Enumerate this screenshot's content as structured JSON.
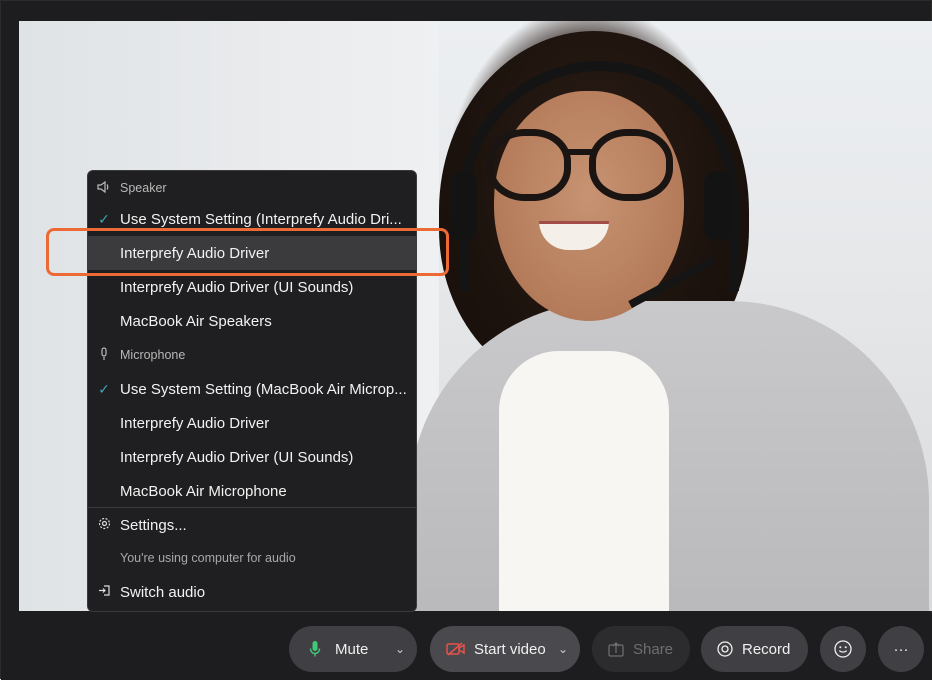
{
  "colors": {
    "accent_check": "#3aa6b9",
    "annotation": "#ec6a36",
    "mic_icon": "#41c77a",
    "video_off_icon": "#e5534b"
  },
  "menu": {
    "speaker_section": "Speaker",
    "speaker_items": [
      {
        "label": "Use System Setting (Interprefy Audio Dri...",
        "checked": true
      },
      {
        "label": "Interprefy Audio Driver",
        "checked": false,
        "highlighted": true
      },
      {
        "label": "Interprefy Audio Driver (UI Sounds)",
        "checked": false
      },
      {
        "label": "MacBook Air Speakers",
        "checked": false
      }
    ],
    "microphone_section": "Microphone",
    "microphone_items": [
      {
        "label": "Use System Setting (MacBook Air Microp...",
        "checked": true
      },
      {
        "label": "Interprefy Audio Driver",
        "checked": false
      },
      {
        "label": "Interprefy Audio Driver (UI Sounds)",
        "checked": false
      },
      {
        "label": "MacBook Air Microphone",
        "checked": false
      }
    ],
    "settings_label": "Settings...",
    "audio_note": "You're using computer for audio",
    "switch_audio_label": "Switch audio"
  },
  "toolbar": {
    "mute_label": "Mute",
    "start_video_label": "Start video",
    "share_label": "Share",
    "record_label": "Record",
    "more_label": "···"
  }
}
